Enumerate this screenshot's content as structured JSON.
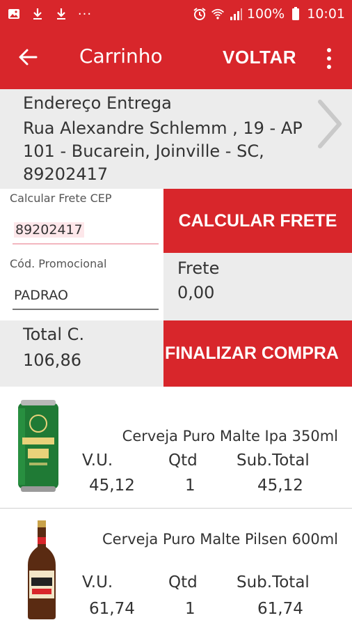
{
  "statusbar": {
    "battery": "100%",
    "time": "10:01"
  },
  "appbar": {
    "title": "Carrinho",
    "voltar": "VOLTAR"
  },
  "address": {
    "label": "Endereço Entrega",
    "text": "Rua Alexandre Schlemm , 19 - AP 101 - Bucarein, Joinville - SC, 89202417"
  },
  "form": {
    "cep_label": "Calcular Frete CEP",
    "cep_value": "89202417",
    "promo_label": "Cód. Promocional",
    "promo_value": "PADRAO"
  },
  "actions": {
    "calcular": "CALCULAR FRETE",
    "finalizar": "FINALIZAR COMPRA"
  },
  "frete": {
    "label": "Frete",
    "value": "0,00"
  },
  "total": {
    "label": "Total C.",
    "value": "106,86"
  },
  "columns": {
    "vu": "V.U.",
    "qtd": "Qtd",
    "subtotal": "Sub.Total"
  },
  "products": [
    {
      "name": "Cerveja Puro Malte Ipa 350ml",
      "vu": "45,12",
      "qtd": "1",
      "subtotal": "45,12"
    },
    {
      "name": "Cerveja Puro Malte Pilsen 600ml",
      "vu": "61,74",
      "qtd": "1",
      "subtotal": "61,74"
    }
  ],
  "colors": {
    "brand_red": "#d8262b",
    "panel_gray": "#ececec"
  }
}
